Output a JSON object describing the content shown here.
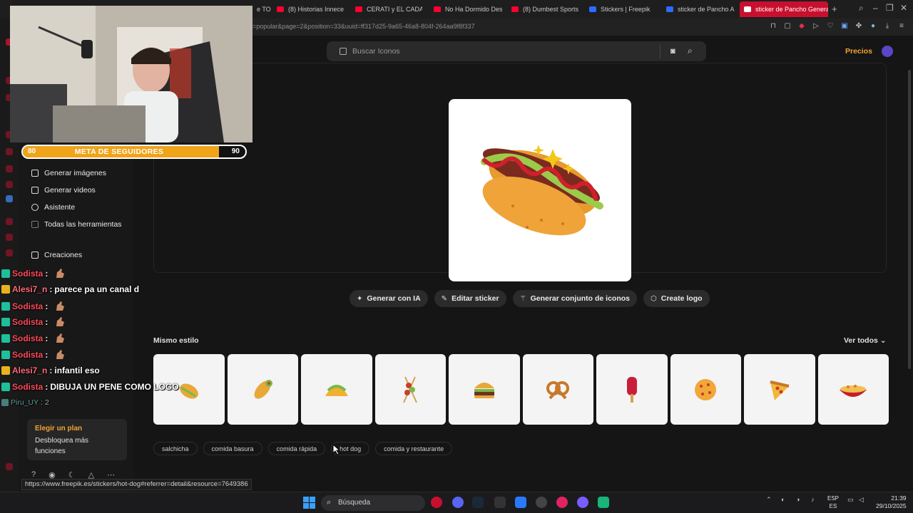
{
  "browser": {
    "tabs": [
      {
        "label": "e TO",
        "type": "yt"
      },
      {
        "label": "(8) Historias Innece",
        "type": "yt"
      },
      {
        "label": "CERATI y EL CADAVE",
        "type": "yt"
      },
      {
        "label": "No Ha Dormido Des",
        "type": "yt"
      },
      {
        "label": "(8) Dumbest Sports",
        "type": "yt"
      },
      {
        "label": "Stickers | Freepik",
        "type": "fp"
      },
      {
        "label": "sticker de Pancho A",
        "type": "fp"
      },
      {
        "label": "sticker de Pancho Genera",
        "type": "fp",
        "active": true
      }
    ],
    "url": "=popular&page=2&position=33&uuid=ff317d25-9a65-46a8-804f-264aa9f8f337",
    "status_link": "https://www.freepik.es/stickers/hot-dog#referrer=detail&resource=7649386"
  },
  "sidebar": {
    "items": [
      {
        "label": "Generar imágenes",
        "icon": "image-icon"
      },
      {
        "label": "Generar videos",
        "icon": "video-icon"
      },
      {
        "label": "Asistente",
        "icon": "chat-icon"
      },
      {
        "label": "Todas las herramientas",
        "icon": "grid-icon"
      },
      {
        "label": "Creaciones",
        "icon": "folder-icon"
      }
    ],
    "plan": {
      "title": "Elegir un plan",
      "desc": "Desbloquea más funciones"
    }
  },
  "header": {
    "search_placeholder": "Buscar Iconos",
    "pricing": "Precios"
  },
  "actions": [
    {
      "label": "Generar con IA",
      "icon": "sparkle-icon"
    },
    {
      "label": "Editar sticker",
      "icon": "pencil-icon"
    },
    {
      "label": "Generar conjunto de iconos",
      "icon": "wand-icon"
    },
    {
      "label": "Create logo",
      "icon": "logo-icon"
    }
  ],
  "related": {
    "title": "Mismo estilo",
    "see_all": "Ver todos",
    "thumbnails": [
      "taco-sticker",
      "burrito-sticker",
      "taco-sticker",
      "skewers-sticker",
      "burger-sticker",
      "pretzel-sticker",
      "popsicle-sticker",
      "cookie-sticker",
      "pizza-slice-sticker",
      "noodle-bowl-sticker"
    ]
  },
  "tags": [
    "salchicha",
    "comida basura",
    "comida rápida",
    "hot dog",
    "comida y restaurante"
  ],
  "stream": {
    "goal": {
      "current": "80",
      "label": "META DE SEGUIDORES",
      "target": "90",
      "progress": 0.88
    },
    "chat": [
      {
        "user": "Sodista",
        "sep": " :",
        "text": "",
        "emote": true,
        "badge": "green"
      },
      {
        "user": "Alesi7_n",
        "sep": " :",
        "text": "parece pa un canal d",
        "emote": false,
        "badge": "gold"
      },
      {
        "user": "Sodista",
        "sep": " :",
        "text": "",
        "emote": true,
        "badge": "green"
      },
      {
        "user": "Sodista",
        "sep": " :",
        "text": "",
        "emote": true,
        "badge": "green"
      },
      {
        "user": "Sodista",
        "sep": " :",
        "text": "",
        "emote": true,
        "badge": "green"
      },
      {
        "user": "Sodista",
        "sep": " :",
        "text": "",
        "emote": true,
        "badge": "green"
      },
      {
        "user": "Alesi7_n",
        "sep": " :",
        "text": "infantil eso",
        "emote": false,
        "badge": "gold"
      },
      {
        "user": "Sodista",
        "sep": " :",
        "text": "DIBUJA UN PENE COMO LOGO",
        "emote": false,
        "badge": "green"
      },
      {
        "user": "Piru_UY",
        "sep": " :",
        "text": "2",
        "emote": false,
        "badge": "gray"
      }
    ]
  },
  "taskbar": {
    "search": "Búsqueda",
    "lang": "ESP",
    "lang2": "ES",
    "time": "21:39",
    "date": "29/10/2025"
  },
  "colors": {
    "accent": "#f2a533",
    "opera_red": "#c8102e"
  }
}
